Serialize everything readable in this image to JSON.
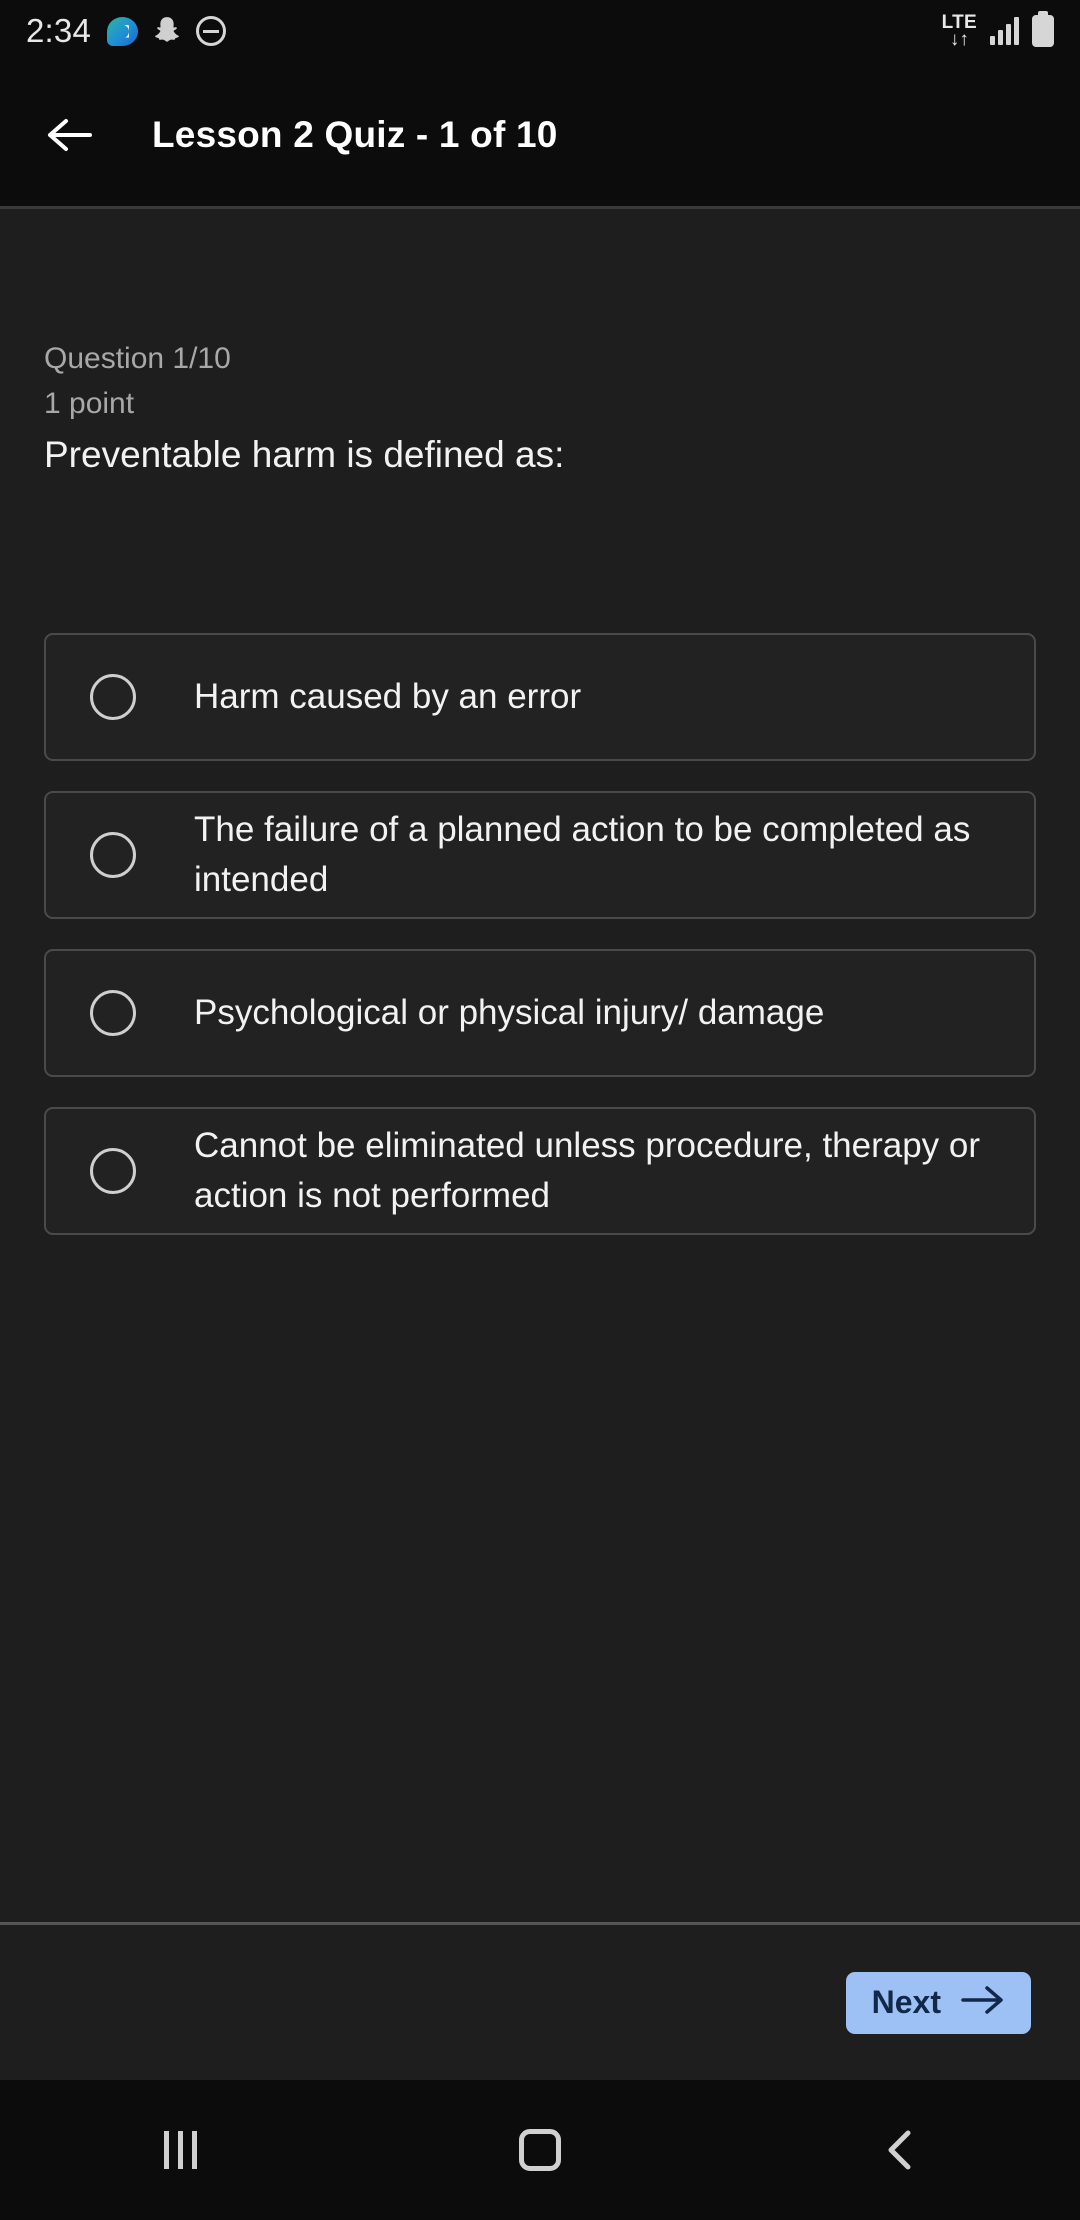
{
  "status_bar": {
    "time": "2:34",
    "icons": [
      "message-bubble-icon",
      "snapchat-ghost-icon",
      "do-not-disturb-icon"
    ],
    "network_type": "LTE",
    "data_arrows": "↓↑",
    "signal_bars": 4,
    "battery": "full"
  },
  "app_bar": {
    "back_icon": "back-arrow-icon",
    "title": "Lesson 2 Quiz - 1 of 10"
  },
  "question": {
    "counter": "Question 1/10",
    "points": "1 point",
    "prompt": "Preventable harm is defined as:"
  },
  "options": [
    {
      "id": "option-a",
      "label": "Harm caused by an error",
      "selected": false
    },
    {
      "id": "option-b",
      "label": "The failure of a planned action to be completed as intended",
      "selected": false
    },
    {
      "id": "option-c",
      "label": "Psychological or physical injury/ damage",
      "selected": false
    },
    {
      "id": "option-d",
      "label": "Cannot be eliminated unless procedure, therapy or action is not performed",
      "selected": false
    }
  ],
  "footer": {
    "next_label": "Next",
    "next_icon": "arrow-right-icon"
  },
  "nav_bar": {
    "recents": "recents-icon",
    "home": "home-icon",
    "back": "back-chevron-icon"
  },
  "colors": {
    "background": "#1e1e1e",
    "bar_background": "#0c0c0c",
    "accent": "#9ec1f5",
    "accent_text": "#11284a",
    "option_border": "#4a4a4a",
    "muted_text": "#a8a8a8"
  }
}
